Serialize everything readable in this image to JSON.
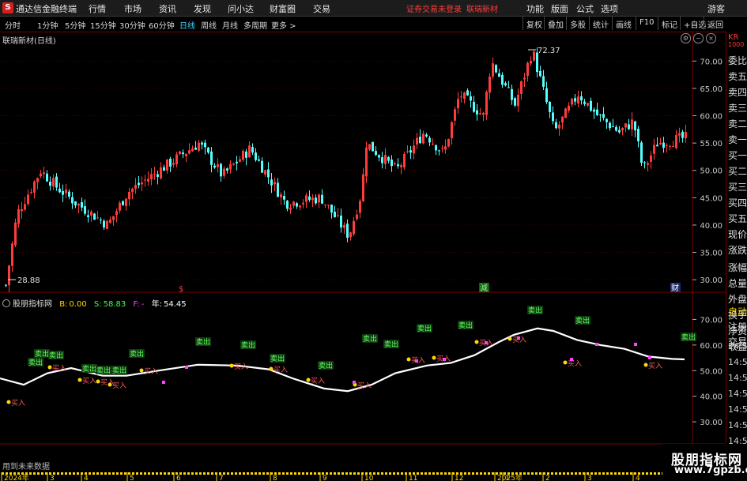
{
  "app": {
    "logo": "S",
    "title": "通达信金融终端"
  },
  "menu": [
    "行情",
    "市场",
    "资讯",
    "发现",
    "问小达",
    "财富圈",
    "交易"
  ],
  "login": {
    "status": "证券交易未登录",
    "stock": "联瑞新材"
  },
  "right_menu": [
    "功能",
    "版面",
    "公式",
    "选项"
  ],
  "guest": "游客",
  "periods": [
    "分时",
    "1分钟",
    "5分钟",
    "15分钟",
    "30分钟",
    "60分钟",
    "日线",
    "周线",
    "月线",
    "多周期",
    "更多 >"
  ],
  "active_period": "日线",
  "tools": [
    "复权",
    "叠加",
    "多股",
    "统计",
    "画线",
    "F10",
    "标记",
    "+自选",
    "返回"
  ],
  "main_chart": {
    "title": "联瑞新材(日线)",
    "price_ticks": [
      "70.00",
      "65.00",
      "60.00",
      "55.00",
      "50.00",
      "45.00",
      "40.00",
      "35.00",
      "30.00"
    ],
    "high_label": "72.37",
    "low_label": "28.88",
    "markers": [
      "$",
      "減",
      "财"
    ]
  },
  "side_panel": [
    "KR",
    "1000",
    "委比",
    "卖五",
    "卖四",
    "卖三",
    "卖二",
    "卖一",
    "买一",
    "买二",
    "买三",
    "买四",
    "买五",
    "现价",
    "涨跌",
    "涨幅",
    "总量",
    "外盘",
    "换手",
    "净资",
    "收益",
    "自动",
    "注册",
    "交易",
    "14:56",
    "14:56",
    "14:56",
    "14:56",
    "14:56",
    "14:56",
    "14:56"
  ],
  "indicator": {
    "name": "股朋指标网",
    "values": [
      {
        "label": "B:",
        "value": "0.00",
        "color": "#ffd800"
      },
      {
        "label": "S:",
        "value": "58.83",
        "color": "#44ff44"
      },
      {
        "label": "F:",
        "value": "-",
        "color": "#ff44ff"
      },
      {
        "label": "年:",
        "value": "54.45",
        "color": "#ffffff"
      }
    ],
    "axis_ticks": [
      "70.00",
      "60.00",
      "50.00",
      "40.00",
      "30.00"
    ],
    "buy_label": "买入",
    "sell_label": "卖出"
  },
  "bottom_note": "用到未来数据",
  "date_axis": [
    "2024年",
    "3",
    "4",
    "5",
    "6",
    "7",
    "8",
    "9",
    "10",
    "11",
    "12",
    "2025年",
    "1",
    "2",
    "3",
    "4",
    "5"
  ],
  "watermark": {
    "line1": "股朋指标网",
    "line2": "www.7gpzb.com"
  },
  "colors": {
    "up": "#ff3c3c",
    "down": "#54ffff",
    "grid": "#7a0000",
    "buy": "#ff3c3c",
    "sell": "#44ff44"
  }
}
